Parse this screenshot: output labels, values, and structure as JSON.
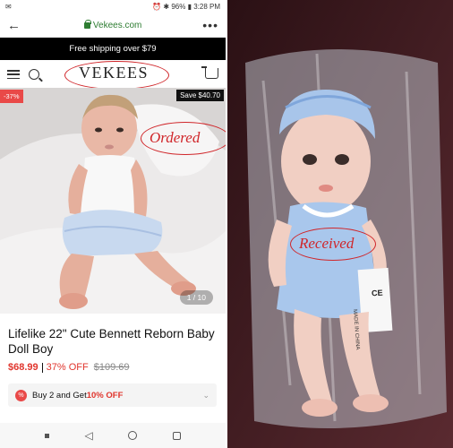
{
  "status": {
    "left": "✉",
    "right": "⏰ ✱ 96% ▮ 3:28 PM"
  },
  "browser": {
    "url": "Vekees.com",
    "back": "←",
    "menu": "⋮"
  },
  "promo_banner": "Free shipping over $79",
  "store": {
    "logo": "VEKEES"
  },
  "gallery": {
    "discount_badge": "-37%",
    "save_badge": "Save $40.70",
    "counter": "1 / 10"
  },
  "annotations": {
    "ordered": "Ordered",
    "received": "Received"
  },
  "product": {
    "title": "Lifelike 22\" Cute Bennett Reborn Baby Doll Boy",
    "price": "$68.99",
    "discount": "37% OFF",
    "original_price": "$109.69"
  },
  "promotion": {
    "icon": "%",
    "text_pre": "Buy 2 and Get ",
    "text_bold": "10% OFF",
    "chevron": "⌄"
  },
  "package_label": {
    "mark": "CE",
    "text": "MADE IN CHINA"
  },
  "colors": {
    "accent_red": "#d0262a",
    "price_red": "#e0352d",
    "url_green": "#2e7d32"
  }
}
